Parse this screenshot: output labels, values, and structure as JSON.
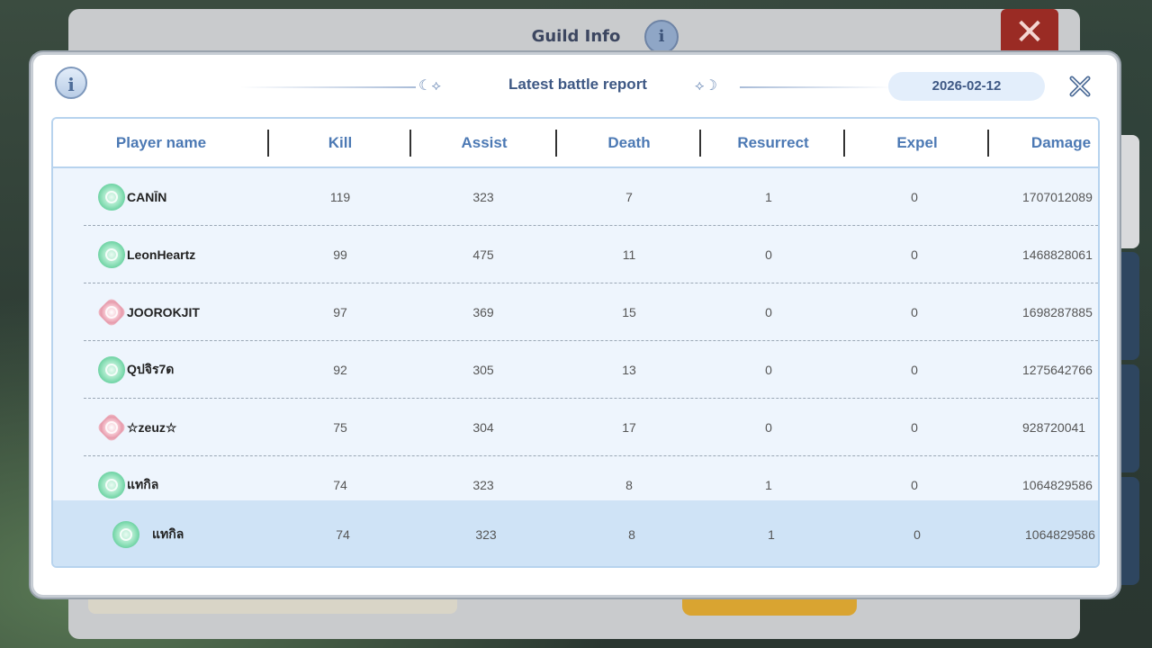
{
  "background": {
    "title": "Guild Info",
    "info_glyph": "i",
    "close_glyph": "✕"
  },
  "dialog": {
    "info_glyph": "i",
    "title": "Latest battle report",
    "ornament_left": "☾⟡",
    "ornament_right": "⟡☽",
    "date": "2026-02-12",
    "close_icon": "close-icon"
  },
  "table": {
    "headers": [
      "Player name",
      "Kill",
      "Assist",
      "Death",
      "Resurrect",
      "Expel",
      "Damage"
    ],
    "rows": [
      {
        "emblem": "green",
        "name": "CANĪN",
        "kill": "119",
        "assist": "323",
        "death": "7",
        "resurrect": "1",
        "expel": "0",
        "damage": "1707012089"
      },
      {
        "emblem": "green",
        "name": "LeonHeartz",
        "kill": "99",
        "assist": "475",
        "death": "11",
        "resurrect": "0",
        "expel": "0",
        "damage": "1468828061"
      },
      {
        "emblem": "pink",
        "name": "JOOROKJIT",
        "kill": "97",
        "assist": "369",
        "death": "15",
        "resurrect": "0",
        "expel": "0",
        "damage": "1698287885"
      },
      {
        "emblem": "green",
        "name": "Qปจิร7ด",
        "kill": "92",
        "assist": "305",
        "death": "13",
        "resurrect": "0",
        "expel": "0",
        "damage": "1275642766"
      },
      {
        "emblem": "pink",
        "name": "☆zeuz☆",
        "kill": "75",
        "assist": "304",
        "death": "17",
        "resurrect": "0",
        "expel": "0",
        "damage": "928720041"
      },
      {
        "emblem": "green",
        "name": "แทกิล",
        "kill": "74",
        "assist": "323",
        "death": "8",
        "resurrect": "1",
        "expel": "0",
        "damage": "1064829586"
      }
    ],
    "self_row": {
      "emblem": "green",
      "name": "แทกิล",
      "kill": "74",
      "assist": "323",
      "death": "8",
      "resurrect": "1",
      "expel": "0",
      "damage": "1064829586"
    }
  },
  "colors": {
    "header_text": "#4c79b4",
    "title_text": "#3e5884",
    "highlight_row": "#cfe3f6"
  }
}
